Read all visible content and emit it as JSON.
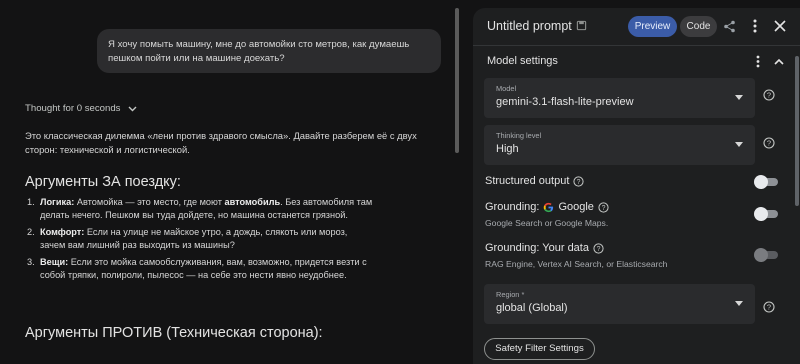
{
  "chat": {
    "user_message_line1": "Я хочу помыть машину, мне до автомойки сто метров, как думаешь",
    "user_message_line2": "пешком пойти или на машине доехать?",
    "thought_label": "Thought for 0 seconds",
    "intro_line1": "Это классическая дилемма «лени против здравого смысла». Давайте разберем её с двух",
    "intro_line2": "сторон: технической и логистической.",
    "heading_for": "Аргументы ЗА поездку:",
    "arguments": [
      {
        "num": "1.",
        "lead": "Логика:",
        "pre": " Автомойка — это место, где моют ",
        "bold": "автомобиль",
        "post": ". Без автомобиля там делать нечего. Пешком вы туда дойдете, но машина останется грязной."
      },
      {
        "num": "2.",
        "lead": "Комфорт:",
        "pre": " Если на улице не майское утро, а дождь, слякоть или мороз, зачем вам лишний раз выходить из машины?",
        "bold": "",
        "post": ""
      },
      {
        "num": "3.",
        "lead": "Вещи:",
        "pre": " Если это мойка самообслуживания, вам, возможно, придется везти с собой тряпки, полироли, пылесос — на себе это нести явно неудобнее.",
        "bold": "",
        "post": ""
      }
    ],
    "heading_against": "Аргументы ПРОТИВ (Техническая сторона):"
  },
  "panel": {
    "title": "Untitled prompt",
    "preview_label": "Preview",
    "code_label": "Code",
    "model_settings_label": "Model settings",
    "model": {
      "label": "Model",
      "value": "gemini-3.1-flash-lite-preview"
    },
    "thinking": {
      "label": "Thinking level",
      "value": "High"
    },
    "structured_output_label": "Structured output",
    "grounding_google": {
      "label": "Grounding:",
      "brand": "Google",
      "sub": "Google Search or Google Maps."
    },
    "grounding_data": {
      "label": "Grounding:  Your data",
      "sub": "RAG Engine, Vertex AI Search, or Elasticsearch"
    },
    "region": {
      "label": "Region *",
      "value": "global (Global)"
    },
    "safety_label": "Safety Filter Settings"
  },
  "colors": {
    "accent": "#3b5ca8",
    "background": "#131314",
    "panel": "#1e1f20"
  }
}
